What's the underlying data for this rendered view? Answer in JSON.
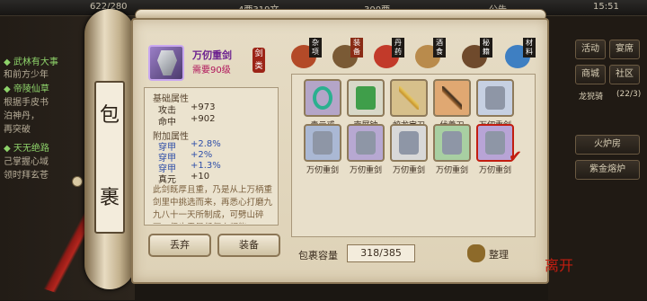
{
  "topbar": {
    "power": "622/280",
    "copper": "4两319文",
    "silver": "300两",
    "notice": "公告",
    "clock": "15:51"
  },
  "log": [
    "◆ 武林有大事",
    "  和前方少年",
    "◆ 帝陵仙草",
    "  根据手皮书",
    "  泊神丹，",
    "  再突破",
    "◆ 天无绝路",
    "  己掌握心域",
    "  领时拜玄苍"
  ],
  "side": [
    "活动",
    "宴席",
    "商城",
    "社区",
    "龙猊骑",
    "(22/3)",
    "火炉房",
    "紫金熔炉"
  ],
  "scroll": {
    "char1": "包",
    "char2": "裹"
  },
  "item": {
    "name": "万仞重剑",
    "requirement": "需要90级",
    "category": "剑类",
    "base_title": "基础属性",
    "base": [
      {
        "k": "攻击",
        "v": "+973"
      },
      {
        "k": "命中",
        "v": "+902"
      }
    ],
    "extra_title": "附加属性",
    "extra": [
      {
        "k": "穿甲",
        "v": "+2.8%"
      },
      {
        "k": "穿甲",
        "v": "+2%"
      },
      {
        "k": "穿甲",
        "v": "+1.3%"
      },
      {
        "k": "真元",
        "v": "+10"
      }
    ],
    "description": "此剑既厚且重，乃是从上万柄重剑里中挑选而来，再悉心打磨九九八十一天所制成，可劈山碎石，但也需是任何人都能"
  },
  "buttons": {
    "discard": "丢弃",
    "equip": "装备"
  },
  "tabs": [
    {
      "label": "杂项"
    },
    {
      "label": "装备"
    },
    {
      "label": "丹药"
    },
    {
      "label": "酒食"
    },
    {
      "label": "秘籍"
    },
    {
      "label": "材料"
    }
  ],
  "grid": [
    {
      "label": "青云戒"
    },
    {
      "label": "南屏钟"
    },
    {
      "label": "蛟龙宝刀"
    },
    {
      "label": "伏羲刀"
    },
    {
      "label": "万仞重剑"
    },
    {
      "label": "万仞重剑"
    },
    {
      "label": "万仞重剑"
    },
    {
      "label": "万仞重剑"
    },
    {
      "label": "万仞重剑"
    },
    {
      "label": "万仞重剑"
    }
  ],
  "capacity": {
    "label": "包裹容量",
    "value": "318/385"
  },
  "organize": "整理",
  "logo": "离开",
  "colors": {
    "paper": "#e6dcc5",
    "accent": "#9c2417",
    "name": "#6a1e8f"
  }
}
